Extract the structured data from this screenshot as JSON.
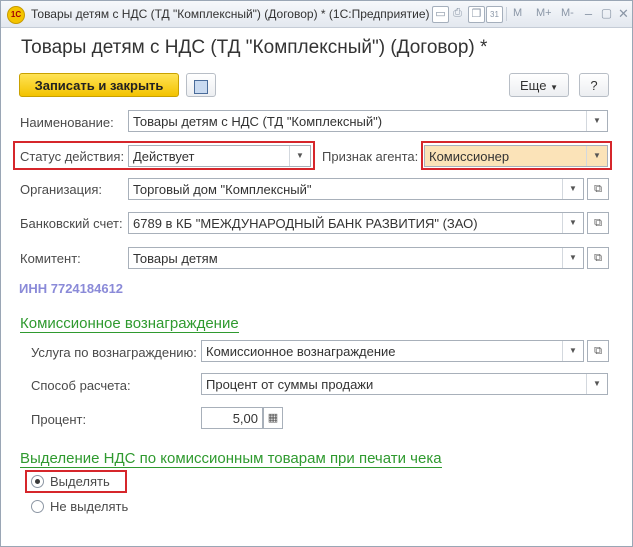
{
  "window": {
    "title": "Товары детям с НДС (ТД \"Комплексный\") (Договор) *  (1С:Предприятие)",
    "app_icon_text": "1С",
    "toolbar_m": "M",
    "toolbar_mplus": "M+",
    "toolbar_mminus": "M-",
    "toolbar_calendar": "31"
  },
  "form": {
    "title": "Товары детям с НДС (ТД \"Комплексный\") (Договор) *",
    "save_close": "Записать и закрыть",
    "more": "Еще",
    "help": "?"
  },
  "fields": {
    "name_label": "Наименование:",
    "name_value": "Товары детям с НДС (ТД \"Комплексный\")",
    "status_label": "Статус действия:",
    "status_value": "Действует",
    "agent_label": "Признак агента:",
    "agent_value": "Комиссионер",
    "org_label": "Организация:",
    "org_value": "Торговый дом \"Комплексный\"",
    "bank_label": "Банковский счет:",
    "bank_value": "6789 в КБ \"МЕЖДУНАРОДНЫЙ БАНК РАЗВИТИЯ\" (ЗАО)",
    "principal_label": "Комитент:",
    "principal_value": "Товары детям",
    "inn": "ИНН 7724184612"
  },
  "commission": {
    "heading": "Комиссионное вознаграждение",
    "service_label": "Услуга по вознаграждению:",
    "service_value": "Комиссионное вознаграждение",
    "method_label": "Способ расчета:",
    "method_value": "Процент от суммы продажи",
    "percent_label": "Процент:",
    "percent_value": "5,00"
  },
  "vat": {
    "heading": "Выделение НДС по комиссионным товарам при печати чека",
    "option_1": "Выделять",
    "option_2": "Не выделять",
    "selected": "Выделять"
  },
  "colors": {
    "primary_button": "#f3c300",
    "section_heading": "#2f9a2f",
    "highlight_border": "#d6262b",
    "agent_field_bg": "#fbe3b8",
    "inn_text": "#8a8ad8"
  }
}
